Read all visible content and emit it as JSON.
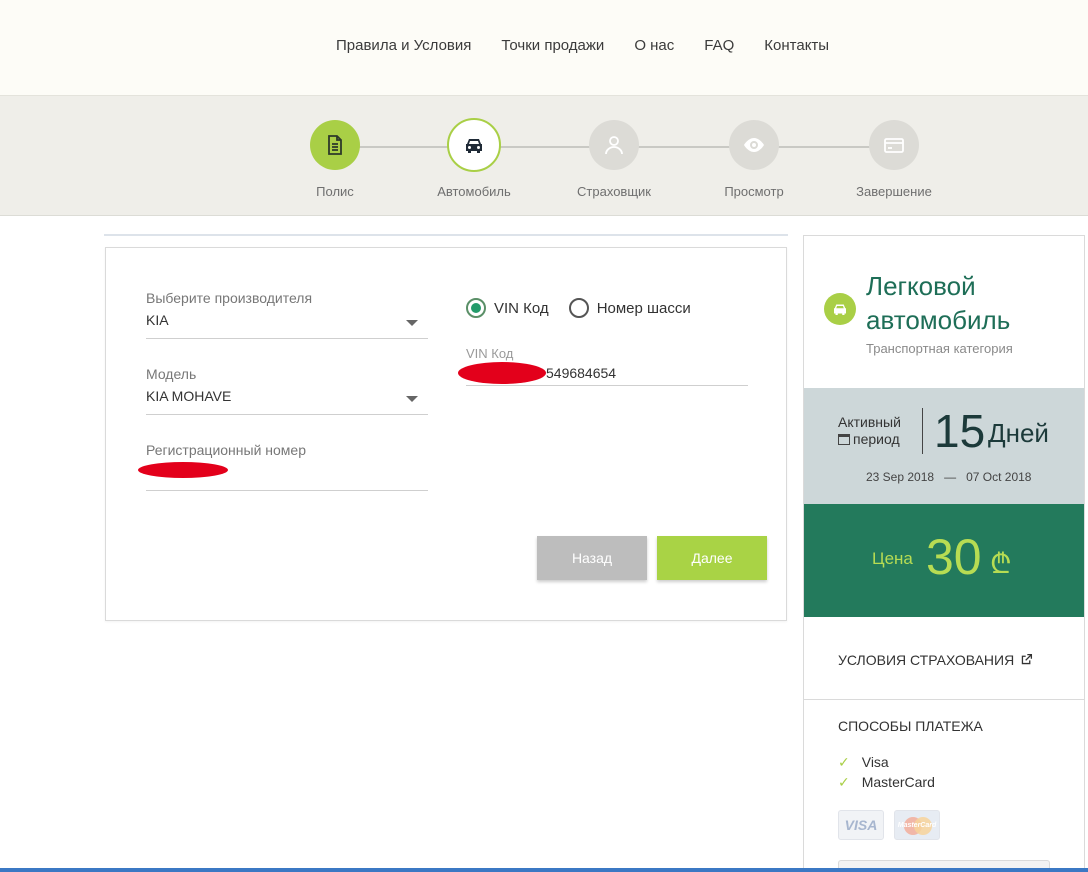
{
  "header": {
    "nav": [
      "Правила и Условия",
      "Точки продажи",
      "О нас",
      "FAQ",
      "Контакты"
    ]
  },
  "steps": [
    {
      "label": "Полис",
      "icon": "document-icon",
      "state": "done"
    },
    {
      "label": "Автомобиль",
      "icon": "car-icon",
      "state": "current"
    },
    {
      "label": "Страховщик",
      "icon": "user-icon",
      "state": "pending"
    },
    {
      "label": "Просмотр",
      "icon": "eye-icon",
      "state": "pending"
    },
    {
      "label": "Завершение",
      "icon": "credit-card-icon",
      "state": "pending"
    }
  ],
  "form": {
    "manufacturer": {
      "label": "Выберите производителя",
      "value": "KIA"
    },
    "model": {
      "label": "Модель",
      "value": "KIA MOHAVE"
    },
    "reg_number": {
      "label": "Регистрационный номер",
      "value": ""
    },
    "id_type": {
      "options": [
        "VIN Код",
        "Номер шасси"
      ],
      "selected": "VIN Код"
    },
    "vin": {
      "label": "VIN Код",
      "value": "549684654"
    },
    "buttons": {
      "back": "Назад",
      "next": "Далее"
    }
  },
  "summary": {
    "title": "Легковой автомобиль",
    "subtitle": "Транспортная категория",
    "period": {
      "label_line1": "Активный",
      "label_line2": "период",
      "count": "15",
      "unit": "Дней",
      "start": "23 Sep 2018",
      "separator": "—",
      "end": "07 Oct 2018"
    },
    "price": {
      "label": "Цена",
      "value": "30",
      "currency": "₾"
    },
    "terms_link": "УСЛОВИЯ СТРАХОВАНИЯ",
    "payment": {
      "title": "СПОСОБЫ ПЛАТЕЖА",
      "methods": [
        "Visa",
        "MasterCard"
      ],
      "visa_logo": "VISA",
      "mastercard_logo": "MasterCard"
    }
  },
  "colors": {
    "accent_green": "#a9cf46",
    "dark_green": "#237a5c",
    "period_bg": "#cdd7d9"
  }
}
